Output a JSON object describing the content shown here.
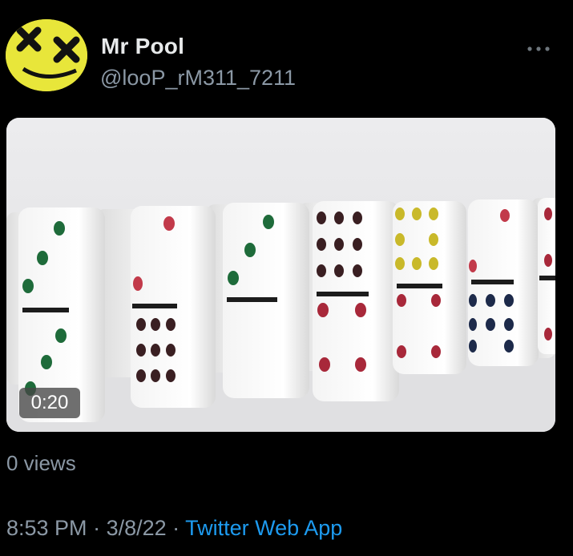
{
  "tweet": {
    "display_name": "Mr Pool",
    "handle": "@looP_rM311_7211",
    "more_icon": "more-horizontal-icon",
    "avatar_color": "#e8e63a",
    "media": {
      "type": "video",
      "duration": "0:20",
      "subject": "dominoes"
    },
    "views": "0 views",
    "time": "8:53 PM",
    "separator_1": " · ",
    "date": "3/8/22",
    "separator_2": " · ",
    "source": "Twitter Web App",
    "accent_color": "#1d9bf0",
    "muted_color": "#8b98a5"
  }
}
